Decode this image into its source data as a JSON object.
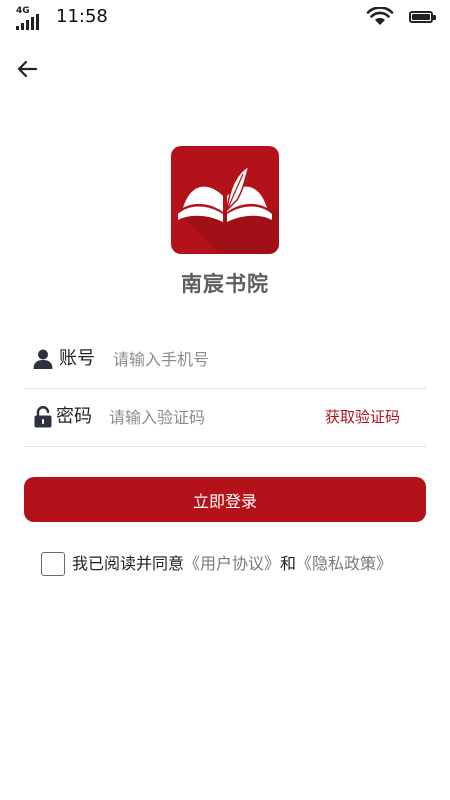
{
  "status_bar": {
    "network": "4G",
    "time": "11:58",
    "battery_level": 1.0
  },
  "icons": {
    "back": "arrow-left-icon",
    "user": "user-icon",
    "lock": "unlock-icon",
    "logo": "open-book-quill-icon"
  },
  "brand": {
    "name": "南宸书院"
  },
  "form": {
    "account_label": "账号",
    "account_placeholder": "请输入手机号",
    "code_label": "密码",
    "code_placeholder": "请输入验证码",
    "get_code_label": "获取验证码"
  },
  "login_button_label": "立即登录",
  "agreement": {
    "prefix": "我已阅读并同意",
    "user_agreement": "《用户协议》",
    "and": "和",
    "privacy_policy": "《隐私政策》"
  },
  "colors": {
    "brand": "#b3121a",
    "link": "#7a7a7a",
    "divider": "#e3e3e3"
  }
}
